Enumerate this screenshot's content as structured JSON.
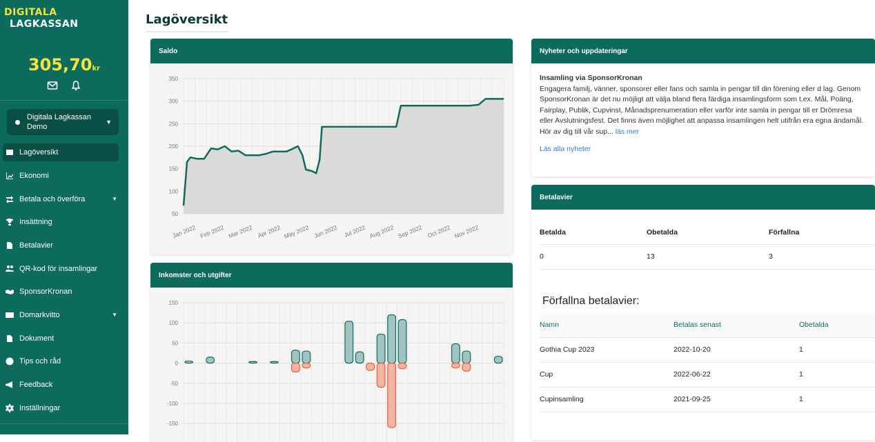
{
  "sidebar": {
    "logo_line1": "DIGITALA",
    "logo_line2": "LAGKASSAN",
    "balance": "305,70",
    "balance_unit": "kr",
    "club": {
      "name_line1": "Digitala Lagkassan",
      "name_line2": "Demo"
    },
    "items": [
      {
        "label": "Lagöversikt",
        "icon": "dashboard-icon"
      },
      {
        "label": "Ekonomi",
        "icon": "chart-icon"
      },
      {
        "label": "Betala och överföra",
        "icon": "transfer-icon"
      },
      {
        "label": "Insättning",
        "icon": "trophy-icon"
      },
      {
        "label": "Betalavier",
        "icon": "file-icon"
      },
      {
        "label": "QR-kod för insamlingar",
        "icon": "users-icon"
      },
      {
        "label": "SponsorKronan",
        "icon": "handshake-icon"
      },
      {
        "label": "Domarkvitto",
        "icon": "card-icon"
      },
      {
        "label": "Dokument",
        "icon": "document-icon"
      },
      {
        "label": "Tips och råd",
        "icon": "info-icon"
      },
      {
        "label": "Feedback",
        "icon": "megaphone-icon"
      },
      {
        "label": "Inställningar",
        "icon": "gear-icon"
      }
    ]
  },
  "page": {
    "title": "Lagöversikt"
  },
  "saldo": {
    "title": "Saldo",
    "chart_data": {
      "type": "area",
      "x_ticks": [
        "Jan 2022",
        "Feb 2022",
        "Mar 2022",
        "Apr 2022",
        "May 2022",
        "Jun 2022",
        "Jul 2022",
        "Aug 2022",
        "Sep 2022",
        "Oct 2022",
        "Nov 2022"
      ],
      "y_ticks": [
        50,
        100,
        150,
        200,
        250,
        300,
        350
      ],
      "ylim": [
        50,
        350
      ],
      "points": [
        [
          0,
          68
        ],
        [
          0.15,
          165
        ],
        [
          0.3,
          175
        ],
        [
          0.6,
          172
        ],
        [
          0.9,
          172
        ],
        [
          1.2,
          195
        ],
        [
          1.5,
          193
        ],
        [
          1.8,
          200
        ],
        [
          2.1,
          188
        ],
        [
          2.4,
          190
        ],
        [
          2.7,
          180
        ],
        [
          3.0,
          180
        ],
        [
          3.3,
          180
        ],
        [
          3.6,
          183
        ],
        [
          3.9,
          188
        ],
        [
          4.2,
          188
        ],
        [
          4.5,
          188
        ],
        [
          4.8,
          195
        ],
        [
          5.0,
          200
        ],
        [
          5.2,
          180
        ],
        [
          5.35,
          148
        ],
        [
          5.6,
          145
        ],
        [
          5.8,
          140
        ],
        [
          5.95,
          170
        ],
        [
          6.05,
          243
        ],
        [
          6.5,
          243
        ],
        [
          7.5,
          243
        ],
        [
          8.5,
          243
        ],
        [
          9.3,
          243
        ],
        [
          9.5,
          290
        ],
        [
          10.0,
          290
        ],
        [
          11.0,
          290
        ],
        [
          12.5,
          290
        ],
        [
          12.9,
          292
        ],
        [
          13.2,
          305
        ],
        [
          14.0,
          305
        ]
      ],
      "x_max": 14,
      "grid": true
    }
  },
  "income": {
    "title": "Inkomster och utgifter",
    "chart_data": {
      "type": "bar",
      "y_ticks": [
        150,
        100,
        50,
        0,
        -50,
        -100,
        -150
      ],
      "ylim": [
        -160,
        150
      ],
      "series": [
        {
          "values": [
            5,
            0,
            15,
            0,
            0,
            0,
            4,
            0,
            4,
            0,
            32,
            30,
            0,
            0,
            0,
            104,
            28,
            0,
            72,
            120,
            108,
            0,
            0,
            0,
            0,
            48,
            30,
            0,
            0,
            17
          ]
        },
        {
          "values": [
            0,
            0,
            0,
            0,
            0,
            0,
            0,
            0,
            0,
            0,
            -22,
            -12,
            0,
            0,
            0,
            0,
            0,
            -18,
            -60,
            -160,
            -14,
            0,
            0,
            0,
            0,
            -12,
            -20,
            0,
            0,
            0
          ]
        }
      ],
      "colors": [
        "#9fc4c1",
        "#f2b5a2"
      ]
    }
  },
  "news": {
    "title": "Nyheter och uppdateringar",
    "heading": "Insamling via SponsorKronan",
    "body": "Engagera familj, vänner, sponsorer eller fans och samla in pengar till din förening eller d lag. Genom SponsorKronan är det nu möjligt att välja bland flera färdiga insamlingsform som t.ex. Mål, Poäng, Fairplay, Publik, Cupvinst, Månadsprenumeration eller varför inte samla in pengar till er Drömresa eller Avslutningsfest. Det finns även möjlighet att anpassa insamlingen helt utifrån era egna ändamål. Hör av dig till vår sup...",
    "read_more": "läs mer",
    "all_news": "Läs alla nyheter"
  },
  "betalavier": {
    "title": "Betalavier",
    "headers": [
      "Betalda",
      "Obetalda",
      "Förfallna"
    ],
    "values": [
      "0",
      "13",
      "3"
    ]
  },
  "overdue": {
    "title": "Förfallna betalavier:",
    "headers": [
      "Namn",
      "Betalas senast",
      "Obetalda"
    ],
    "rows": [
      [
        "Gothia Cup 2023",
        "2022-10-20",
        "1"
      ],
      [
        "Cup",
        "2022-06-22",
        "1"
      ],
      [
        "Cupinsamling",
        "2021-09-25",
        "1"
      ]
    ]
  }
}
